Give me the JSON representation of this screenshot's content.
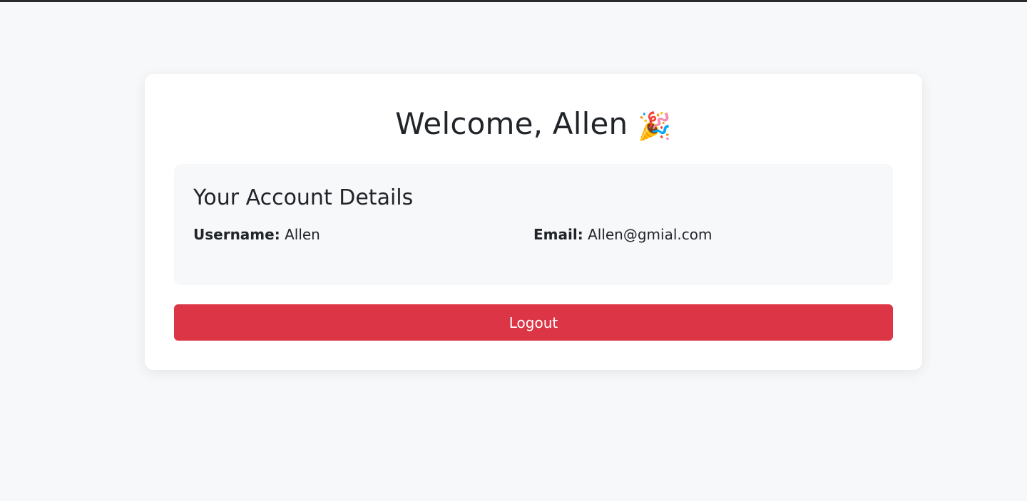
{
  "welcome": {
    "title": "Welcome, Allen",
    "emoji": "🎉"
  },
  "account": {
    "heading": "Your Account Details",
    "username_label": "Username:",
    "username_value": "Allen",
    "email_label": "Email:",
    "email_value": "Allen@gmial.com"
  },
  "actions": {
    "logout_label": "Logout"
  },
  "colors": {
    "background": "#f7f8fa",
    "card": "#ffffff",
    "logout": "#dc3545"
  }
}
